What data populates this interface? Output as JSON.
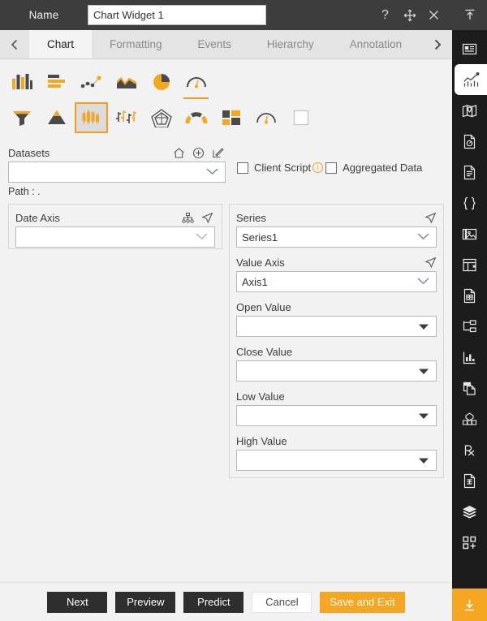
{
  "titlebar": {
    "name_label": "Name",
    "widget_name": "Chart Widget 1",
    "name_placeholder": "",
    "icons": [
      {
        "name": "help-icon",
        "glyph": "?"
      },
      {
        "name": "move-icon",
        "glyph": "move"
      },
      {
        "name": "close-icon",
        "glyph": "x"
      }
    ],
    "rail_collapse": "collapse-up-icon"
  },
  "tabs": {
    "prev_label": "‹",
    "next_label": "›",
    "items": [
      {
        "label": "Chart",
        "active": true
      },
      {
        "label": "Formatting",
        "active": false
      },
      {
        "label": "Events",
        "active": false
      },
      {
        "label": "Hierarchy",
        "active": false
      },
      {
        "label": "Annotation",
        "active": false
      }
    ]
  },
  "chart_types": {
    "row1": [
      {
        "name": "column-chart-icon",
        "selected": false,
        "underline": false
      },
      {
        "name": "bar-chart-icon",
        "selected": false,
        "underline": false
      },
      {
        "name": "scatter-line-chart-icon",
        "selected": false,
        "underline": false
      },
      {
        "name": "area-chart-icon",
        "selected": false,
        "underline": false
      },
      {
        "name": "pie-chart-icon",
        "selected": false,
        "underline": false
      },
      {
        "name": "gauge-chart-icon",
        "selected": false,
        "underline": true
      }
    ],
    "row2": [
      {
        "name": "funnel-chart-icon",
        "selected": false,
        "underline": false
      },
      {
        "name": "pyramid-chart-icon",
        "selected": false,
        "underline": false
      },
      {
        "name": "candlestick-chart-icon",
        "selected": true,
        "underline": false
      },
      {
        "name": "range-chart-icon",
        "selected": false,
        "underline": false
      },
      {
        "name": "radar-chart-icon",
        "selected": false,
        "underline": false
      },
      {
        "name": "semi-gauge-chart-icon",
        "selected": false,
        "underline": false
      },
      {
        "name": "treemap-chart-icon",
        "selected": false,
        "underline": false
      },
      {
        "name": "dial-gauge-chart-icon",
        "selected": false,
        "underline": false
      },
      {
        "name": "blank-chart-icon",
        "selected": false,
        "underline": false
      }
    ]
  },
  "datasets": {
    "label": "Datasets",
    "value": "",
    "placeholder": "",
    "icons": [
      {
        "name": "home-icon"
      },
      {
        "name": "add-circle-icon"
      },
      {
        "name": "edit-icon"
      }
    ],
    "path_label": "Path :",
    "path_value": "."
  },
  "options": {
    "client_script": {
      "label": "Client Script",
      "checked": false,
      "info": "i"
    },
    "aggregated_data": {
      "label": "Aggregated Data",
      "checked": false
    }
  },
  "date_axis": {
    "label": "Date Axis",
    "value": "",
    "icons": [
      {
        "name": "hierarchy-icon"
      },
      {
        "name": "navigate-icon"
      }
    ]
  },
  "series_panel": {
    "series": {
      "label": "Series",
      "value": "Series1",
      "icon": "navigate-icon"
    },
    "value_axis": {
      "label": "Value Axis",
      "value": "Axis1",
      "icon": "navigate-icon"
    },
    "fields": [
      {
        "label": "Open Value",
        "value": "",
        "name": "open-value-select"
      },
      {
        "label": "Close Value",
        "value": "",
        "name": "close-value-select"
      },
      {
        "label": "Low Value",
        "value": "",
        "name": "low-value-select"
      },
      {
        "label": "High Value",
        "value": "",
        "name": "high-value-select"
      }
    ]
  },
  "footer": {
    "next": "Next",
    "preview": "Preview",
    "predict": "Predict",
    "cancel": "Cancel",
    "save_exit": "Save and Exit"
  },
  "rail": {
    "items": [
      {
        "name": "widget-card-icon",
        "active": false
      },
      {
        "name": "chart-icon",
        "active": true
      },
      {
        "name": "map-icon",
        "active": false
      },
      {
        "name": "gauge-document-icon",
        "active": false
      },
      {
        "name": "document-icon",
        "active": false
      },
      {
        "name": "code-braces-icon",
        "active": false
      },
      {
        "name": "image-icon",
        "active": false
      },
      {
        "name": "table-icon",
        "active": false
      },
      {
        "name": "report-document-icon",
        "active": false
      },
      {
        "name": "tree-hierarchy-icon",
        "active": false
      },
      {
        "name": "bar-chart-panel-icon",
        "active": false
      },
      {
        "name": "copy-document-icon",
        "active": false
      },
      {
        "name": "database-cube-icon",
        "active": false
      },
      {
        "name": "prescription-rx-icon",
        "active": false
      },
      {
        "name": "text-document-icon",
        "active": false
      },
      {
        "name": "layers-icon",
        "active": false
      },
      {
        "name": "add-widget-icon",
        "active": false
      }
    ],
    "download": "download-icon"
  },
  "colors": {
    "accent": "#f5a623",
    "titlebar_bg": "#3d3d3d",
    "rail_bg": "#1c1c1c",
    "panel_bg": "#f2f2f2"
  }
}
